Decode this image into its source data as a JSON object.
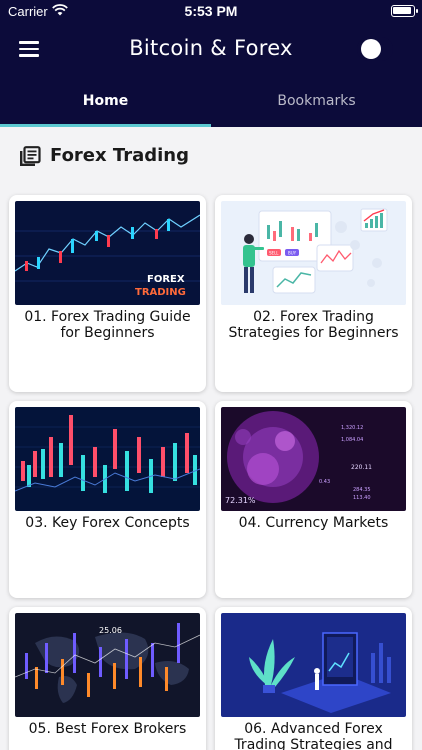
{
  "status_bar": {
    "carrier": "Carrier",
    "time": "5:53 PM"
  },
  "header": {
    "title": "Bitcoin & Forex",
    "theme_toggle_on": false
  },
  "tabs": [
    {
      "label": "Home",
      "active": true
    },
    {
      "label": "Bookmarks",
      "active": false
    }
  ],
  "section": {
    "title": "Forex Trading",
    "icon": "library-books-icon"
  },
  "cards": [
    {
      "title": "01. Forex Trading Guide for Beginners",
      "image_text_1": "FOREX",
      "image_text_2": "TRADING"
    },
    {
      "title": "02. Forex Trading Strategies for Beginners",
      "image_text_1": "SELL",
      "image_text_2": "BUY"
    },
    {
      "title": "03. Key Forex Concepts"
    },
    {
      "title": "04. Currency Markets",
      "image_text_1": "72.31%",
      "image_text_2": "220.11"
    },
    {
      "title": "05. Best Forex Brokers",
      "image_text_1": "25.06"
    },
    {
      "title": "06. Advanced Forex Trading Strategies and"
    }
  ],
  "colors": {
    "header_bg": "#0c0b3a",
    "tab_indicator": "#5cc8d0",
    "page_bg": "#f3f3f5"
  }
}
